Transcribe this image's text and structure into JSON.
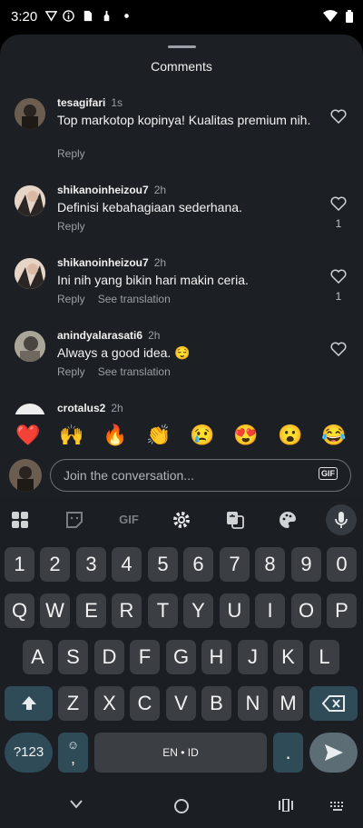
{
  "status_bar": {
    "time": "3:20"
  },
  "sheet": {
    "title": "Comments"
  },
  "comments": [
    {
      "username": "tesagifari",
      "time": "1s",
      "text": "Top markotop kopinya! Kualitas premium nih.",
      "reply": "Reply",
      "translate": "",
      "likes": ""
    },
    {
      "username": "shikanoinheizou7",
      "time": "2h",
      "text": "Definisi kebahagiaan sederhana.",
      "reply": "Reply",
      "translate": "",
      "likes": "1"
    },
    {
      "username": "shikanoinheizou7",
      "time": "2h",
      "text": "Ini nih yang bikin hari makin ceria.",
      "reply": "Reply",
      "translate": "See translation",
      "likes": "1"
    },
    {
      "username": "anindyalarasati6",
      "time": "2h",
      "text": "Always a good idea. 😌",
      "reply": "Reply",
      "translate": "See translation",
      "likes": ""
    },
    {
      "username": "crotalus2",
      "time": "2h",
      "text": "",
      "reply": "",
      "translate": "",
      "likes": ""
    }
  ],
  "emojis": [
    "❤️",
    "🙌",
    "🔥",
    "👏",
    "😢",
    "😍",
    "😮",
    "😂"
  ],
  "composer": {
    "placeholder": "Join the conversation...",
    "gif_label": "GIF"
  },
  "keyboard": {
    "toolbar_gif": "GIF",
    "row_numbers": [
      "1",
      "2",
      "3",
      "4",
      "5",
      "6",
      "7",
      "8",
      "9",
      "0"
    ],
    "row_q": [
      "Q",
      "W",
      "E",
      "R",
      "T",
      "Y",
      "U",
      "I",
      "O",
      "P"
    ],
    "row_a": [
      "A",
      "S",
      "D",
      "F",
      "G",
      "H",
      "J",
      "K",
      "L"
    ],
    "row_z": [
      "Z",
      "X",
      "C",
      "V",
      "B",
      "N",
      "M"
    ],
    "symbols_key": "?123",
    "space_label": "EN • ID",
    "period_key": ".",
    "emoji_comma_top": "☺",
    "emoji_comma_bottom": ","
  },
  "colors": {
    "sheet_bg": "#1c1f23",
    "keyboard_bg": "#1b1f23",
    "key_bg": "#3b3f44",
    "special_key_bg": "#2f4b58"
  }
}
